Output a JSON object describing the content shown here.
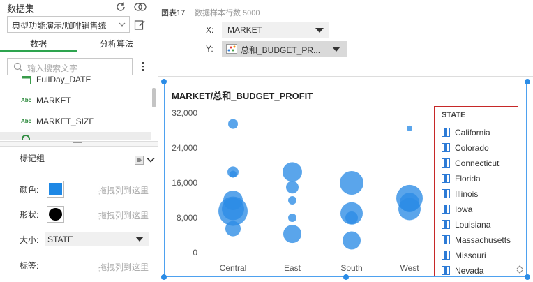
{
  "left_panel": {
    "dataset_title": "数据集",
    "dataset_value": "典型功能演示/咖啡销售统",
    "tabs": [
      {
        "label": "数据",
        "active": true
      },
      {
        "label": "分析算法",
        "active": false
      }
    ],
    "search_placeholder": "输入搜索文字",
    "fields": [
      {
        "type": "date",
        "name": "FullDay_DATE"
      },
      {
        "type": "Abc",
        "name": "MARKET"
      },
      {
        "type": "Abc",
        "name": "MARKET_SIZE"
      }
    ],
    "marks_title": "标记组",
    "color_label": "颜色:",
    "shape_label": "形状:",
    "size_label": "大小:",
    "tag_label": "标签:",
    "drop_hint": "拖拽列到这里",
    "size_value": "STATE",
    "color_value": "#1e88e5",
    "shape_value": "#000000"
  },
  "right_panel": {
    "chart_name": "图表17",
    "sample_rows": "数据样本行数 5000",
    "x_label": "X:",
    "x_value": "MARKET",
    "y_label": "Y:",
    "y_value": "总和_BUDGET_PR...",
    "accent": "#2b8ce6"
  },
  "chart_data": {
    "type": "scatter",
    "title": "MARKET/总和_BUDGET_PROFIT",
    "categories": [
      "Central",
      "East",
      "South",
      "West"
    ],
    "yticks": [
      "32,000",
      "24,000",
      "16,000",
      "8,000",
      "0"
    ],
    "ylim": [
      0,
      32000
    ],
    "grid": false,
    "legend_title": "STATE",
    "legend_position": "right",
    "legend": [
      "California",
      "Colorado",
      "Connecticut",
      "Florida",
      "Illinois",
      "Iowa",
      "Louisiana",
      "Massachusetts",
      "Missouri",
      "Nevada"
    ],
    "points": [
      {
        "category": "Central",
        "y": 29500,
        "size": 7
      },
      {
        "category": "Central",
        "y": 18500,
        "size": 8
      },
      {
        "category": "Central",
        "y": 18000,
        "size": 5
      },
      {
        "category": "Central",
        "y": 12000,
        "size": 14
      },
      {
        "category": "Central",
        "y": 10000,
        "size": 16
      },
      {
        "category": "Central",
        "y": 9500,
        "size": 21
      },
      {
        "category": "Central",
        "y": 5500,
        "size": 11
      },
      {
        "category": "East",
        "y": 18500,
        "size": 14
      },
      {
        "category": "East",
        "y": 15000,
        "size": 9
      },
      {
        "category": "East",
        "y": 12000,
        "size": 6
      },
      {
        "category": "East",
        "y": 8000,
        "size": 6
      },
      {
        "category": "East",
        "y": 4300,
        "size": 13
      },
      {
        "category": "South",
        "y": 16000,
        "size": 17
      },
      {
        "category": "South",
        "y": 9000,
        "size": 16
      },
      {
        "category": "South",
        "y": 8000,
        "size": 9
      },
      {
        "category": "South",
        "y": 2800,
        "size": 13
      },
      {
        "category": "West",
        "y": 28500,
        "size": 4
      },
      {
        "category": "West",
        "y": 12500,
        "size": 19
      },
      {
        "category": "West",
        "y": 11500,
        "size": 14
      },
      {
        "category": "West",
        "y": 10000,
        "size": 16
      }
    ]
  }
}
